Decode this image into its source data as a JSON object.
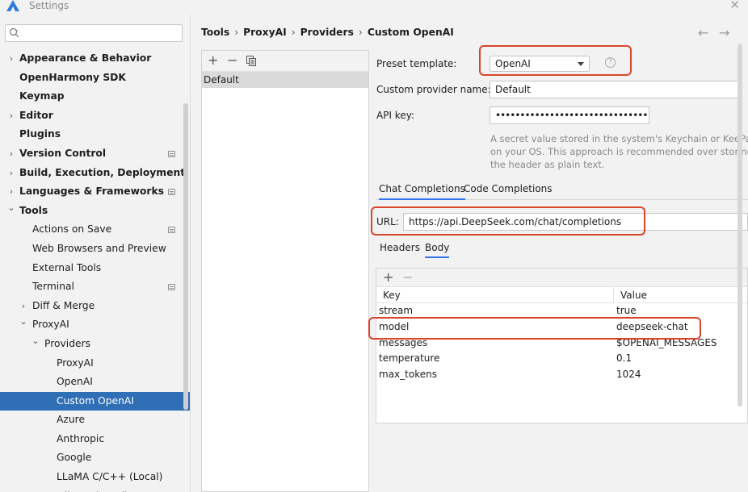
{
  "window": {
    "title": "Settings",
    "logo_icon": "app-logo-icon",
    "close_icon": "close-icon"
  },
  "search": {
    "value": "",
    "icon": "search-icon"
  },
  "sidebar": {
    "items": [
      {
        "label": "Appearance & Behavior",
        "bold": true,
        "arrow": "right",
        "level": 0
      },
      {
        "label": "OpenHarmony SDK",
        "bold": true,
        "arrow": null,
        "level": 0
      },
      {
        "label": "Keymap",
        "bold": true,
        "arrow": null,
        "level": 0
      },
      {
        "label": "Editor",
        "bold": true,
        "arrow": "right",
        "level": 0
      },
      {
        "label": "Plugins",
        "bold": true,
        "arrow": null,
        "level": 0
      },
      {
        "label": "Version Control",
        "bold": true,
        "arrow": "right",
        "level": 0,
        "project_icon": true
      },
      {
        "label": "Build, Execution, Deployment",
        "bold": true,
        "arrow": "right",
        "level": 0
      },
      {
        "label": "Languages & Frameworks",
        "bold": true,
        "arrow": "right",
        "level": 0,
        "project_icon": true
      },
      {
        "label": "Tools",
        "bold": true,
        "arrow": "down",
        "level": 0
      },
      {
        "label": "Actions on Save",
        "bold": false,
        "arrow": null,
        "level": 1,
        "project_icon": true
      },
      {
        "label": "Web Browsers and Preview",
        "bold": false,
        "arrow": null,
        "level": 1
      },
      {
        "label": "External Tools",
        "bold": false,
        "arrow": null,
        "level": 1
      },
      {
        "label": "Terminal",
        "bold": false,
        "arrow": null,
        "level": 1,
        "project_icon": true
      },
      {
        "label": "Diff & Merge",
        "bold": false,
        "arrow": "right",
        "level": 1
      },
      {
        "label": "ProxyAI",
        "bold": false,
        "arrow": "down",
        "level": 1
      },
      {
        "label": "Providers",
        "bold": false,
        "arrow": "down",
        "level": 2
      },
      {
        "label": "ProxyAI",
        "bold": false,
        "arrow": null,
        "level": 3
      },
      {
        "label": "OpenAI",
        "bold": false,
        "arrow": null,
        "level": 3
      },
      {
        "label": "Custom OpenAI",
        "bold": false,
        "arrow": null,
        "level": 3,
        "selected": true
      },
      {
        "label": "Azure",
        "bold": false,
        "arrow": null,
        "level": 3
      },
      {
        "label": "Anthropic",
        "bold": false,
        "arrow": null,
        "level": 3
      },
      {
        "label": "Google",
        "bold": false,
        "arrow": null,
        "level": 3
      },
      {
        "label": "LLaMA C/C++ (Local)",
        "bold": false,
        "arrow": null,
        "level": 3
      },
      {
        "label": "Ollama (Local)",
        "bold": false,
        "arrow": null,
        "level": 3
      }
    ]
  },
  "breadcrumb": [
    "Tools",
    "ProxyAI",
    "Providers",
    "Custom OpenAI"
  ],
  "nav": {
    "back_icon": "arrow-left-icon",
    "forward_icon": "arrow-right-icon"
  },
  "provider_list": {
    "toolbar": {
      "add": "+",
      "remove": "−",
      "copy_icon": "copy-icon"
    },
    "items": [
      "Default"
    ]
  },
  "form": {
    "preset_label": "Preset template:",
    "preset_value": "OpenAI",
    "help": "?",
    "name_label": "Custom provider name:",
    "name_value": "Default",
    "apikey_label": "API key:",
    "apikey_value": "••••••••••••••••••••••••••••••••••",
    "hint_lines": [
      "A secret value stored in the system's Keychain or KeePass",
      "on your OS. This approach is recommended over storing",
      "the header as plain text."
    ],
    "tabs": [
      "Chat Completions",
      "Code Completions"
    ],
    "url_label": "URL:",
    "url_value": "https://api.DeepSeek.com/chat/completions",
    "subtabs": [
      "Headers",
      "Body"
    ],
    "table": {
      "toolbar": {
        "add": "+",
        "remove": "−"
      },
      "columns": [
        "Key",
        "Value"
      ],
      "rows": [
        [
          "stream",
          "true"
        ],
        [
          "model",
          "deepseek-chat"
        ],
        [
          "messages",
          "$OPENAI_MESSAGES"
        ],
        [
          "temperature",
          "0.1"
        ],
        [
          "max_tokens",
          "1024"
        ]
      ]
    }
  },
  "colors": {
    "accent": "#3574f0",
    "selection": "#2f6fb5",
    "highlight": "#d9452b"
  }
}
